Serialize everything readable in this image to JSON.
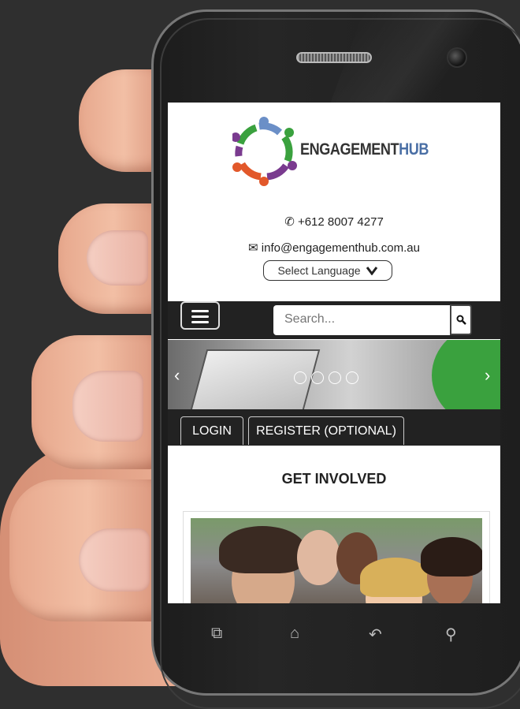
{
  "colors": {
    "background": "#2f2f2f",
    "navbar": "#222222",
    "accent_green": "#3aa13e",
    "brand_blue": "#4a6fa5"
  },
  "brand": {
    "name_dark": "ENGAGEMENT",
    "name_blue": "HUB"
  },
  "contact": {
    "phone": "+612 8007 4277",
    "email": "info@engagementhub.com.au"
  },
  "language": {
    "label": "Select Language"
  },
  "search": {
    "placeholder": "Search..."
  },
  "tabs": [
    {
      "label": "LOGIN"
    },
    {
      "label": "REGISTER (OPTIONAL)"
    }
  ],
  "section": {
    "title": "GET INVOLVED"
  },
  "icons": {
    "phone": "phone-icon",
    "email": "envelope-icon",
    "menu": "hamburger-icon",
    "search": "search-icon",
    "dropdown": "chevron-down-icon",
    "recent_apps": "recent-apps-icon",
    "home": "home-icon",
    "back": "back-icon",
    "device_search": "search-icon"
  }
}
